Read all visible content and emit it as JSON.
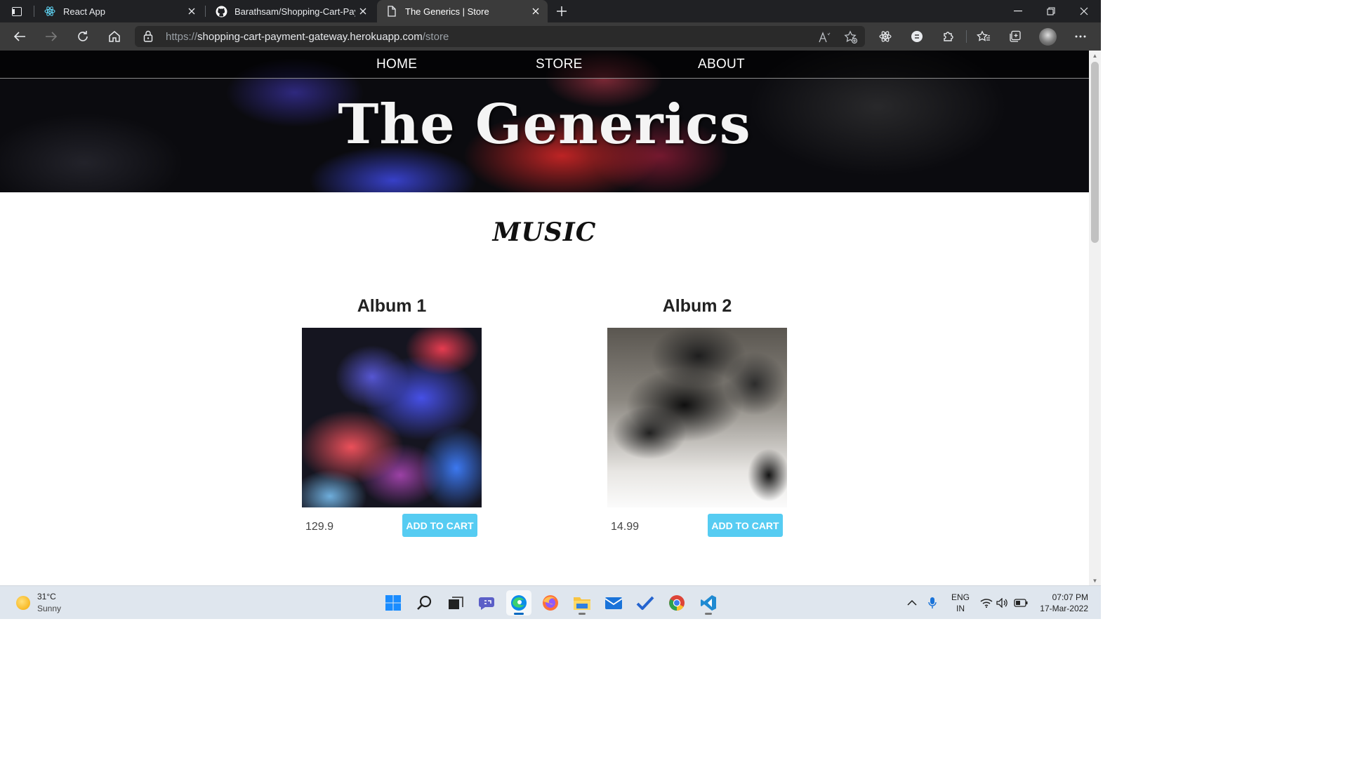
{
  "browser": {
    "tabs": [
      {
        "title": "React App",
        "icon": "react-icon"
      },
      {
        "title": "Barathsam/Shopping-Cart-Paym",
        "icon": "github-icon"
      },
      {
        "title": "The Generics | Store",
        "icon": "page-icon"
      }
    ],
    "url_scheme": "https://",
    "url_host": "shopping-cart-payment-gateway.herokuapp.com",
    "url_path": "/store"
  },
  "site": {
    "nav": [
      "HOME",
      "STORE",
      "ABOUT"
    ],
    "brand": "The Generics",
    "section_title": "MUSIC",
    "albums": [
      {
        "title": "Album 1",
        "price": "129.9",
        "button": "ADD TO CART"
      },
      {
        "title": "Album 2",
        "price": "14.99",
        "button": "ADD TO CART"
      }
    ],
    "accent_color": "#56ccf2"
  },
  "taskbar": {
    "weather_temp": "31°C",
    "weather_cond": "Sunny",
    "lang_line1": "ENG",
    "lang_line2": "IN",
    "time": "07:07 PM",
    "date": "17-Mar-2022"
  }
}
